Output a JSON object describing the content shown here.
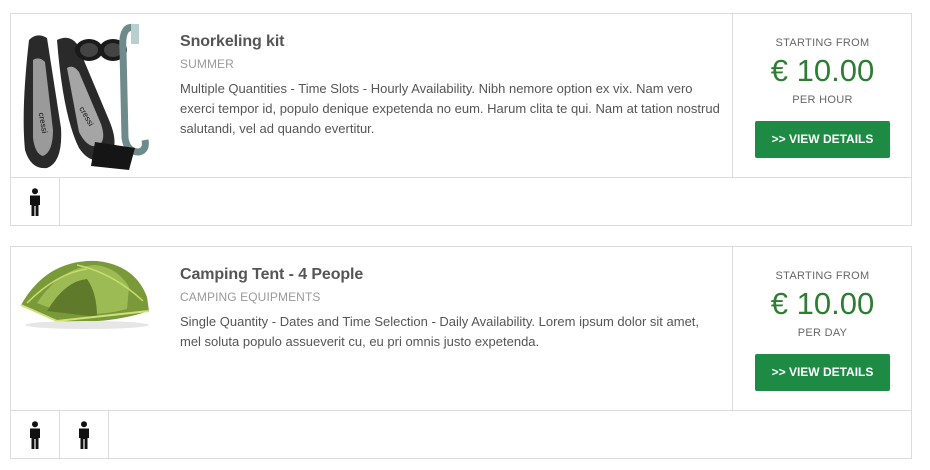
{
  "listings": [
    {
      "title": "Snorkeling kit",
      "category": "SUMMER",
      "description": "Multiple Quantities - Time Slots - Hourly Availability. Nibh nemore option ex vix. Nam vero exerci tempor id, populo denique expetenda no eum. Harum clita te qui. Nam at tation nostrud salutandi, vel ad quando evertitur.",
      "price_label": "STARTING FROM",
      "price": "€ 10.00",
      "unit": "PER HOUR",
      "button_label": ">> VIEW DETAILS",
      "image_icon": "snorkeling-kit-image",
      "person_icons": [
        "person-icon"
      ]
    },
    {
      "title": "Camping Tent - 4 People",
      "category": "CAMPING EQUIPMENTS",
      "description": "Single Quantity - Dates and Time Selection - Daily Availability. Lorem ipsum dolor sit amet, mel soluta populo assueverit cu, eu pri omnis justo expetenda.",
      "price_label": "STARTING FROM",
      "price": "€ 10.00",
      "unit": "PER DAY",
      "button_label": ">> VIEW DETAILS",
      "image_icon": "camping-tent-image",
      "person_icons": [
        "person-icon",
        "person-icon"
      ]
    }
  ],
  "colors": {
    "accent_button": "#1e8b45",
    "price_text": "#2e7d32",
    "border": "#dcdcdc"
  }
}
